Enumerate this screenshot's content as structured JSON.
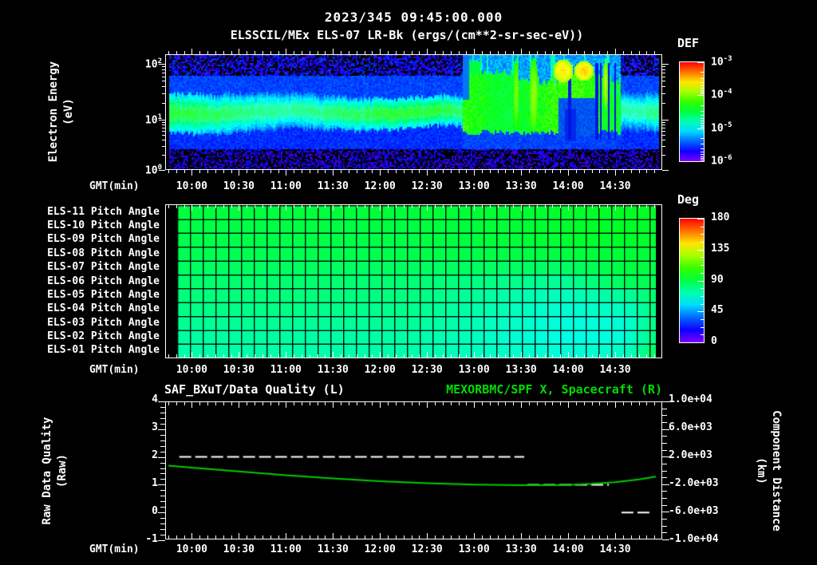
{
  "title": {
    "line1": "2023/345 09:45:00.000",
    "line2": "ELSSCIL/MEx ELS-07 LR-Bk  (ergs/(cm**2-sr-sec-eV))"
  },
  "colors": {
    "background": "#000000",
    "text": "#ffffff",
    "accent_green": "#00dd00",
    "curve_green": "#00cc00"
  },
  "x_axis": {
    "label": "GMT(min)",
    "ticks": [
      "10:00",
      "10:30",
      "11:00",
      "11:30",
      "12:00",
      "12:30",
      "13:00",
      "13:30",
      "14:00",
      "14:30"
    ]
  },
  "top_panel": {
    "y_label": "Electron Energy",
    "y_label_units": "(eV)",
    "y_ticks": [
      "10^2",
      "10^1",
      "10^0"
    ],
    "colorbar_title": "DEF",
    "colorbar_ticks": [
      "10^-3",
      "10^-4",
      "10^-5",
      "10^-6"
    ]
  },
  "middle_panel": {
    "colorbar_title": "Deg",
    "colorbar_ticks": [
      "180",
      "135",
      "90",
      "45",
      "0"
    ]
  },
  "bottom_panel": {
    "left_title": "SAF_BXuT/Data Quality (L)",
    "right_title": "MEXORBMC/SPF X, Spacecraft (R)",
    "left_label": "Raw Data Quality",
    "left_label_units": "(Raw)",
    "left_ticks": [
      "4",
      "3",
      "2",
      "1",
      "0",
      "-1"
    ],
    "right_label": "Component Distance",
    "right_label_units": "(km)",
    "right_ticks": [
      "1.0e+04",
      "6.0e+03",
      "2.0e+03",
      "-2.0e+03",
      "-6.0e+03",
      "-1.0e+04"
    ]
  },
  "chart_data": [
    {
      "panel": "electron_energy_spectrogram",
      "type": "heatmap",
      "title": "ELSSCIL/MEx ELS-07 LR-Bk",
      "units": "ergs/(cm**2-sr-sec-eV)",
      "x_ticks": [
        "10:00",
        "10:30",
        "11:00",
        "11:30",
        "12:00",
        "12:30",
        "13:00",
        "13:30",
        "14:00",
        "14:30"
      ],
      "y_axis": {
        "label": "Electron Energy (eV)",
        "scale": "log",
        "range_eV": [
          1,
          146
        ],
        "ticks": [
          "10^0",
          "10^1",
          "10^2"
        ]
      },
      "colorbar": {
        "title": "DEF",
        "scale": "log",
        "range": [
          1e-06,
          0.001
        ],
        "ticks": [
          "10^-3",
          "10^-4",
          "10^-5",
          "10^-6"
        ]
      },
      "features": {
        "quiet_band": {
          "time": "09:45-12:53",
          "energy_eV": [
            4,
            40
          ],
          "center_eV": 12,
          "peak_flux": 3e-05
        },
        "enhancement": {
          "time": "12:53-14:05",
          "energy_eV": [
            5,
            120
          ],
          "typical_flux": 0.0001
        },
        "hotspots": [
          {
            "time": "13:57",
            "energy_eV": [
              20,
              110
            ],
            "flux": 0.0004
          },
          {
            "time": "14:05",
            "energy_eV": [
              25,
              100
            ],
            "flux": 0.0005
          }
        ],
        "post_enhancement": {
          "time": "14:10-14:55",
          "energy_eV": [
            5,
            50
          ],
          "peak_flux": 2e-05
        }
      }
    },
    {
      "panel": "pitch_angle",
      "type": "heatmap",
      "colorbar": {
        "title": "Deg",
        "range": [
          0,
          180
        ],
        "ticks": [
          180,
          135,
          90,
          45,
          0
        ]
      },
      "x_fractions": [
        0,
        0.5,
        0.8,
        0.93,
        1
      ],
      "rows": [
        {
          "label": "ELS-11 Pitch Angle",
          "deg": [
            90,
            91,
            93,
            95,
            94
          ]
        },
        {
          "label": "ELS-10 Pitch Angle",
          "deg": [
            89,
            90,
            93,
            95,
            93
          ]
        },
        {
          "label": "ELS-09 Pitch Angle",
          "deg": [
            88,
            89,
            92,
            94,
            92
          ]
        },
        {
          "label": "ELS-08 Pitch Angle",
          "deg": [
            87,
            88,
            90,
            92,
            90
          ]
        },
        {
          "label": "ELS-07 Pitch Angle",
          "deg": [
            85,
            85,
            84,
            90,
            89
          ]
        },
        {
          "label": "ELS-06 Pitch Angle",
          "deg": [
            83,
            82,
            76,
            86,
            87
          ]
        },
        {
          "label": "ELS-05 Pitch Angle",
          "deg": [
            81,
            80,
            70,
            76,
            85
          ]
        },
        {
          "label": "ELS-04 Pitch Angle",
          "deg": [
            79,
            78,
            67,
            70,
            83
          ]
        },
        {
          "label": "ELS-03 Pitch Angle",
          "deg": [
            77,
            76,
            65,
            67,
            82
          ]
        },
        {
          "label": "ELS-02 Pitch Angle",
          "deg": [
            75,
            74,
            64,
            66,
            84
          ]
        },
        {
          "label": "ELS-01 Pitch Angle",
          "deg": [
            74,
            73,
            66,
            69,
            88
          ]
        }
      ]
    },
    {
      "panel": "quality_and_distance",
      "type": "line",
      "left_axis": {
        "label": "Raw Data Quality (Raw)",
        "range": [
          -1,
          4
        ]
      },
      "right_axis": {
        "label": "Component Distance (km)",
        "range": [
          -10000,
          10000
        ]
      },
      "left_series": {
        "name": "SAF_BXuT/Data Quality (L)",
        "axis": "left",
        "style": "dashed",
        "segments": [
          {
            "value": 2,
            "from": "09:52",
            "to": "13:32"
          },
          {
            "value": 1,
            "from": "13:34",
            "to": "14:26"
          },
          {
            "value": 0,
            "from": "14:34",
            "to": "14:52"
          }
        ]
      },
      "right_series": {
        "name": "MEXORBMC/SPF X, Spacecraft (R)",
        "axis": "right",
        "style": "solid",
        "points": [
          [
            "09:45",
            700
          ],
          [
            "10:00",
            400
          ],
          [
            "10:30",
            -150
          ],
          [
            "11:00",
            -700
          ],
          [
            "11:30",
            -1150
          ],
          [
            "12:00",
            -1550
          ],
          [
            "12:30",
            -1850
          ],
          [
            "13:00",
            -2050
          ],
          [
            "13:30",
            -2150
          ],
          [
            "13:45",
            -2150
          ],
          [
            "14:00",
            -2100
          ],
          [
            "14:15",
            -1950
          ],
          [
            "14:30",
            -1700
          ],
          [
            "14:45",
            -1300
          ],
          [
            "14:56",
            -900
          ]
        ]
      }
    }
  ]
}
